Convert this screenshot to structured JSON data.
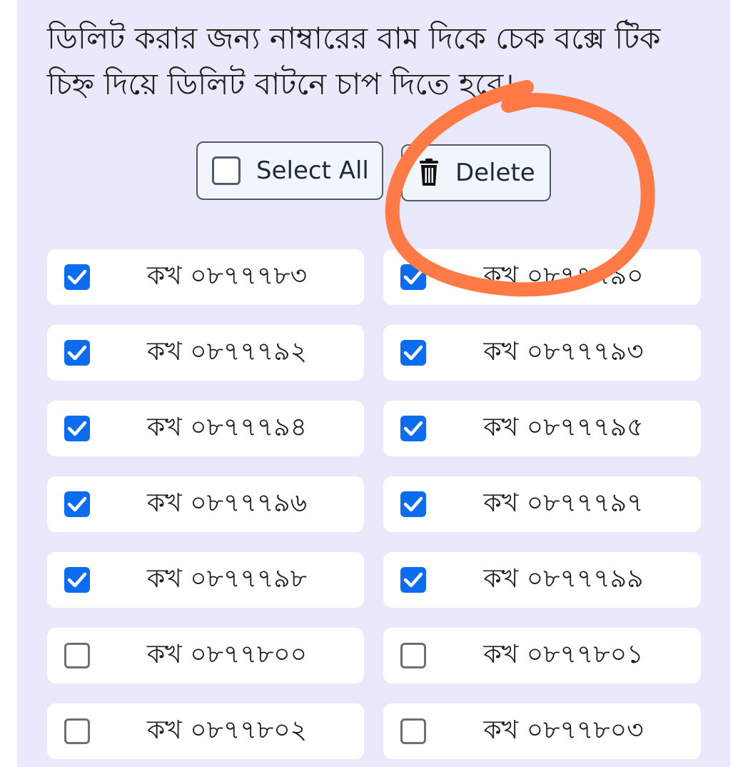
{
  "instruction": "ডিলিট করার জন্য নাম্বারের বাম দিকে চেক বক্সে টিক চিহ্ন দিয়ে ডিলিট বাটনে চাপ দিতে হবে।",
  "toolbar": {
    "select_all_label": "Select All",
    "delete_label": "Delete"
  },
  "colors": {
    "panel": "#e9e9fb",
    "checked": "#0b6cf0",
    "annotation": "#ff7a45"
  },
  "numbers": [
    {
      "label": "কখ ০৮৭৭৭৮৩",
      "checked": true
    },
    {
      "label": "কখ ০৮৭৭৭৯০",
      "checked": true
    },
    {
      "label": "কখ ০৮৭৭৭৯২",
      "checked": true
    },
    {
      "label": "কখ ০৮৭৭৭৯৩",
      "checked": true
    },
    {
      "label": "কখ ০৮৭৭৭৯৪",
      "checked": true
    },
    {
      "label": "কখ ০৮৭৭৭৯৫",
      "checked": true
    },
    {
      "label": "কখ ০৮৭৭৭৯৬",
      "checked": true
    },
    {
      "label": "কখ ০৮৭৭৭৯৭",
      "checked": true
    },
    {
      "label": "কখ ০৮৭৭৭৯৮",
      "checked": true
    },
    {
      "label": "কখ ০৮৭৭৭৯৯",
      "checked": true
    },
    {
      "label": "কখ ০৮৭৭৮০০",
      "checked": false
    },
    {
      "label": "কখ ০৮৭৭৮০১",
      "checked": false
    },
    {
      "label": "কখ ০৮৭৭৮০২",
      "checked": false
    },
    {
      "label": "কখ ০৮৭৭৮০৩",
      "checked": false
    }
  ]
}
